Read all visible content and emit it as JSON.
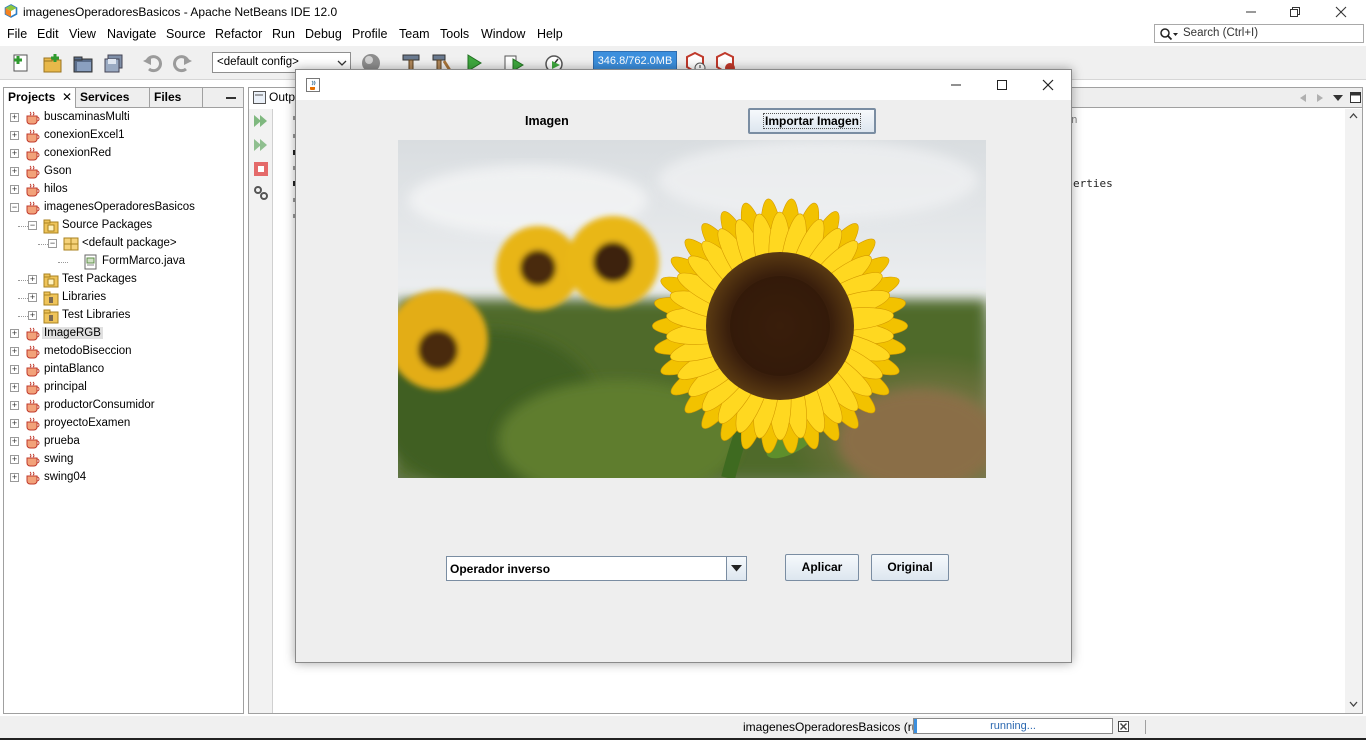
{
  "window": {
    "title": "imagenesOperadoresBasicos - Apache NetBeans IDE 12.0"
  },
  "menu": {
    "items": [
      "File",
      "Edit",
      "View",
      "Navigate",
      "Source",
      "Refactor",
      "Run",
      "Debug",
      "Profile",
      "Team",
      "Tools",
      "Window",
      "Help"
    ]
  },
  "search": {
    "placeholder": "Search (Ctrl+I)"
  },
  "toolbar": {
    "config": "<default config>",
    "memory": "346.8/762.0MB"
  },
  "projects_panel": {
    "tabs": [
      "Projects",
      "Services",
      "Files"
    ],
    "tree": [
      {
        "label": "buscaminasMulti",
        "level": 0,
        "expander": "+",
        "icon": "project-cup-icon"
      },
      {
        "label": "conexionExcel1",
        "level": 0,
        "expander": "+",
        "icon": "project-cup-icon"
      },
      {
        "label": "conexionRed",
        "level": 0,
        "expander": "+",
        "icon": "project-cup-icon"
      },
      {
        "label": "Gson",
        "level": 0,
        "expander": "+",
        "icon": "project-cup-icon"
      },
      {
        "label": "hilos",
        "level": 0,
        "expander": "+",
        "icon": "project-cup-icon"
      },
      {
        "label": "imagenesOperadoresBasicos",
        "level": 0,
        "expander": "−",
        "icon": "project-cup-icon"
      },
      {
        "label": "Source Packages",
        "level": 1,
        "expander": "−",
        "icon": "source-folder-icon"
      },
      {
        "label": "<default package>",
        "level": 2,
        "expander": "−",
        "icon": "package-icon"
      },
      {
        "label": "FormMarco.java",
        "level": 3,
        "expander": "",
        "icon": "java-form-file-icon"
      },
      {
        "label": "Test Packages",
        "level": 1,
        "expander": "+",
        "icon": "source-folder-icon"
      },
      {
        "label": "Libraries",
        "level": 1,
        "expander": "+",
        "icon": "library-folder-icon"
      },
      {
        "label": "Test Libraries",
        "level": 1,
        "expander": "+",
        "icon": "library-folder-icon"
      },
      {
        "label": "ImageRGB",
        "level": 0,
        "expander": "+",
        "icon": "project-cup-icon",
        "selected": true
      },
      {
        "label": "metodoBiseccion",
        "level": 0,
        "expander": "+",
        "icon": "project-cup-icon"
      },
      {
        "label": "pintaBlanco",
        "level": 0,
        "expander": "+",
        "icon": "project-cup-icon"
      },
      {
        "label": "principal",
        "level": 0,
        "expander": "+",
        "icon": "project-cup-icon"
      },
      {
        "label": "productorConsumidor",
        "level": 0,
        "expander": "+",
        "icon": "project-cup-icon"
      },
      {
        "label": "proyectoExamen",
        "level": 0,
        "expander": "+",
        "icon": "project-cup-icon"
      },
      {
        "label": "prueba",
        "level": 0,
        "expander": "+",
        "icon": "project-cup-icon"
      },
      {
        "label": "swing",
        "level": 0,
        "expander": "+",
        "icon": "project-cup-icon"
      },
      {
        "label": "swing04",
        "level": 0,
        "expander": "+",
        "icon": "project-cup-icon"
      }
    ]
  },
  "output_panel": {
    "tab": "Outp",
    "visible_text": [
      "n",
      "erties"
    ]
  },
  "dialog": {
    "label_imagen": "Imagen",
    "import_button": "Importar Imagen",
    "operator_selected": "Operador inverso",
    "apply_button": "Aplicar",
    "original_button": "Original"
  },
  "statusbar": {
    "project": "imagenesOperadoresBasicos (run)",
    "progress_text": "running..."
  },
  "colors": {
    "memory_bar": "#3c8fdd",
    "selection": "#e0e0e0",
    "dialog_bg": "#eeeeee"
  }
}
